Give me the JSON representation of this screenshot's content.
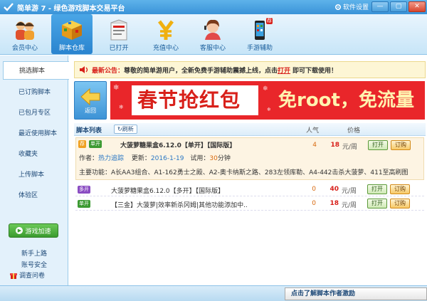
{
  "app": {
    "title": "简单游 7 - 绿色游戏脚本交易平台",
    "settings_label": "软件设置",
    "min_label": "—",
    "max_label": "▢",
    "close_label": "✕"
  },
  "nav": {
    "items": [
      {
        "label": "会员中心",
        "icon": "members-icon"
      },
      {
        "label": "脚本仓库",
        "icon": "warehouse-cube-icon"
      },
      {
        "label": "已打开",
        "icon": "opened-box-icon"
      },
      {
        "label": "充值中心",
        "icon": "yen-icon"
      },
      {
        "label": "客服中心",
        "icon": "support-agent-icon"
      },
      {
        "label": "手游辅助",
        "icon": "phone-icon"
      }
    ],
    "phone_badge": "荐"
  },
  "sidebar": {
    "items": [
      "挑选脚本",
      "已订购脚本",
      "已包月专区",
      "最近使用脚本",
      "收藏夹",
      "上传脚本",
      "体验区"
    ],
    "speed_button": "游戏加速",
    "links": [
      "新手上路",
      "账号安全"
    ],
    "survey": "调查问卷"
  },
  "announce": {
    "prefix": "最新公告：",
    "text": "尊敬的简单游用户，全新免费手游辅助震撼上线，点击",
    "link": "打开",
    "suffix": "即可下载使用！"
  },
  "back": {
    "label": "返回"
  },
  "banner": {
    "text1": "春节抢红包",
    "text2": "免root，免流量"
  },
  "table": {
    "title": "脚本列表",
    "refresh": "刷新",
    "col_popularity": "人气",
    "col_price": "价格",
    "rows": [
      {
        "tag1": "荐",
        "tag2": "单开",
        "name": "大菠萝糖果盒6.12.0【单开】【国际版】",
        "popularity": "4",
        "price": "18",
        "unit": "元/周",
        "open": "打开",
        "buy": "订购",
        "author_label": "作者：",
        "author": "热力追踪",
        "updated_label": "更新：",
        "updated": "2016-1-19",
        "trial_label": "试用：",
        "trial": "30",
        "trial_unit": "分钟",
        "features": "主要功能：A长AA3组合、A1-162勇士之殿、A2-奥卡纳斯之路、283左领库勒、A4-442击杀大菠萝、411至高刷图"
      },
      {
        "tag1": "多开",
        "name": "大菠萝糖果盒6.12.0【多开】【国际版】",
        "popularity": "0",
        "price": "40",
        "unit": "元/周",
        "open": "打开",
        "buy": "订购"
      },
      {
        "tag1": "单开",
        "name": "【三金】大菠萝|效率新杀冈姆|其他功能添加中..",
        "popularity": "0",
        "price": "18",
        "unit": "元/周",
        "open": "打开",
        "buy": "订购"
      }
    ]
  },
  "status": {
    "message": "点击了解脚本作者激励"
  }
}
